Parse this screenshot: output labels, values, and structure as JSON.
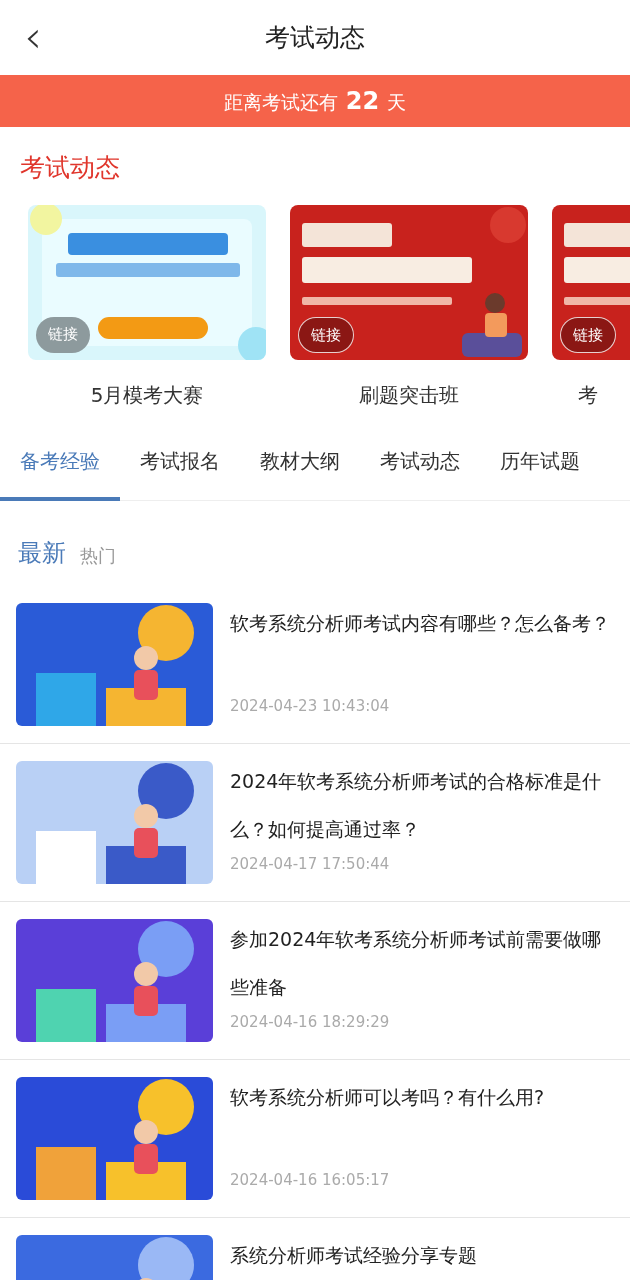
{
  "header": {
    "back": "‹",
    "title": "考试动态"
  },
  "countdown": {
    "before": "距离考试还有",
    "days": "22",
    "after": "天"
  },
  "section_title": "考试动态",
  "banners": [
    {
      "badge": "链接",
      "caption": "5月模考大赛"
    },
    {
      "badge": "链接",
      "caption": "刷题突击班"
    },
    {
      "badge": "链接",
      "caption": "考"
    }
  ],
  "tabs": [
    {
      "label": "备考经验",
      "selected": true
    },
    {
      "label": "考试报名",
      "selected": false
    },
    {
      "label": "教材大纲",
      "selected": false
    },
    {
      "label": "考试动态",
      "selected": false
    },
    {
      "label": "历年试题",
      "selected": false
    }
  ],
  "sort": [
    {
      "label": "最新",
      "selected": true
    },
    {
      "label": "热门",
      "selected": false
    }
  ],
  "articles": [
    {
      "title": "软考系统分析师考试内容有哪些？怎么备考？",
      "date": "2024-04-23 10:43:04"
    },
    {
      "title": "2024年软考系统分析师考试的合格标准是什么？如何提高通过率？",
      "date": "2024-04-17 17:50:44"
    },
    {
      "title": "参加2024年软考系统分析师考试前需要做哪些准备",
      "date": "2024-04-16 18:29:29"
    },
    {
      "title": "软考系统分析师可以考吗？有什么用?",
      "date": "2024-04-16 16:05:17"
    },
    {
      "title": "系统分析师考试经验分享专题"
    }
  ]
}
